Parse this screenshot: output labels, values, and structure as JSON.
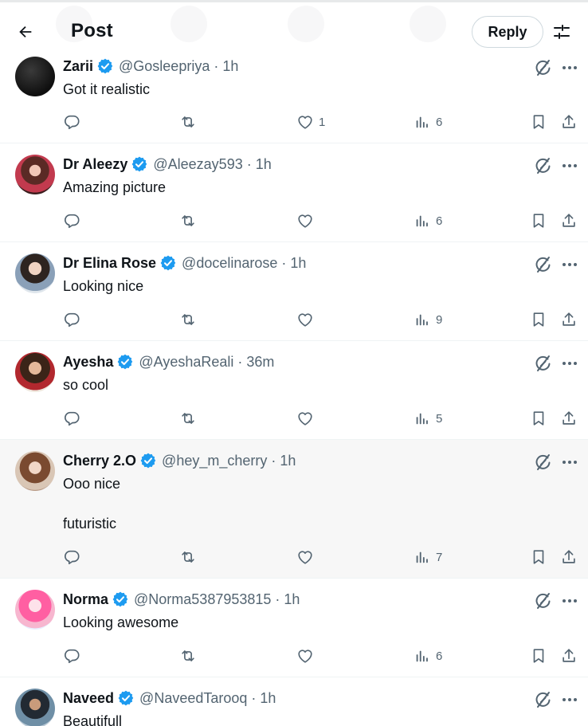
{
  "header": {
    "title": "Post",
    "reply_label": "Reply"
  },
  "icons": {
    "back": "arrow-left-icon",
    "filter": "sliders-icon",
    "verified": "verified-badge-icon",
    "grok": "grok-icon",
    "more": "more-horizontal-icon",
    "reply": "reply-bubble-icon",
    "repost": "repost-icon",
    "like": "heart-icon",
    "views": "views-chart-icon",
    "bookmark": "bookmark-icon",
    "share": "share-icon"
  },
  "colors": {
    "verified": "#1d9bf0",
    "text": "#0f1419",
    "secondary": "#536471",
    "divider": "#eff3f4",
    "highlight_bg": "#f7f7f7"
  },
  "replies": [
    {
      "name": "Zarii",
      "handle": "@Gosleepriya",
      "time": "1h",
      "text": [
        "Got it realistic"
      ],
      "likes": "1",
      "views": "6"
    },
    {
      "name": "Dr Aleezy",
      "handle": "@Aleezay593",
      "time": "1h",
      "text": [
        "Amazing picture"
      ],
      "likes": "",
      "views": "6"
    },
    {
      "name": "Dr Elina Rose",
      "handle": "@docelinarose",
      "time": "1h",
      "text": [
        "Looking nice"
      ],
      "likes": "",
      "views": "9"
    },
    {
      "name": "Ayesha",
      "handle": "@AyeshaReali",
      "time": "36m",
      "text": [
        "so cool"
      ],
      "likes": "",
      "views": "5"
    },
    {
      "name": "Cherry 2.O",
      "handle": "@hey_m_cherry",
      "time": "1h",
      "text": [
        "Ooo nice",
        "",
        "futuristic"
      ],
      "likes": "",
      "views": "7"
    },
    {
      "name": "Norma",
      "handle": "@Norma5387953815",
      "time": "1h",
      "text": [
        "Looking awesome"
      ],
      "likes": "",
      "views": "6"
    },
    {
      "name": "Naveed",
      "handle": "@NaveedTarooq",
      "time": "1h",
      "text": [
        "Beautifull"
      ],
      "likes": "",
      "views": ""
    }
  ]
}
